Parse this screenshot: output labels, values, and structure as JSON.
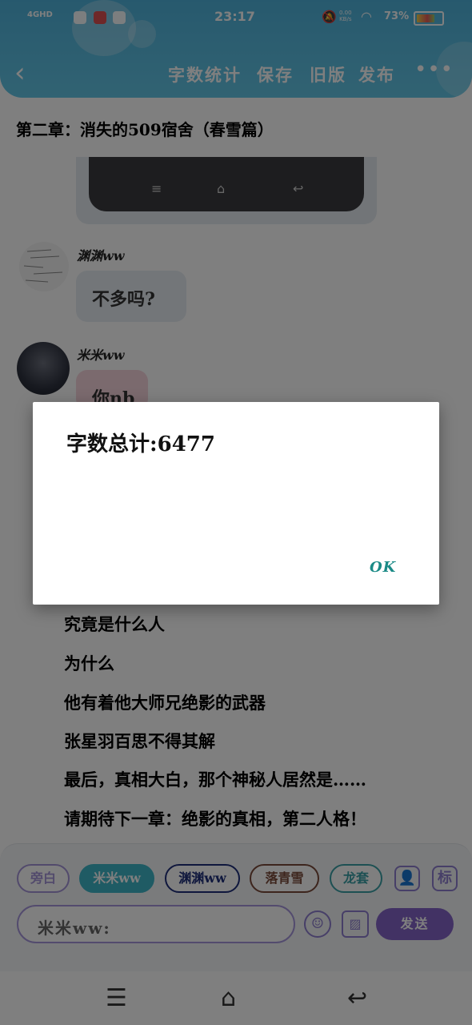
{
  "status_bar": {
    "network": "4GHD",
    "time": "23:17",
    "speed_value": "0.00",
    "speed_unit": "KB/s",
    "battery": "73%"
  },
  "header": {
    "back_icon": "back-arrow-icon",
    "buttons": [
      "字数统计",
      "保存",
      "旧版",
      "发布"
    ],
    "more_icon": "more-dots-icon",
    "color": "#5bbde3"
  },
  "chapter_title": "第二章：消失的509宿舍（春雪篇）",
  "chat": [
    {
      "user": "渊渊ww",
      "text": "不多吗?"
    },
    {
      "user": "米米ww",
      "text": "你nb"
    }
  ],
  "story_lines": [
    "究竟是什么人",
    "为什么",
    "他有着他大师兄绝影的武器",
    "张星羽百思不得其解",
    "最后，真相大白，那个神秘人居然是……",
    "请期待下一章：绝影的真相，第二人格！"
  ],
  "roles": [
    {
      "label": "旁白",
      "color": "#a595d8",
      "filled": false
    },
    {
      "label": "米米ww",
      "color": "#3fb6c9",
      "filled": true
    },
    {
      "label": "渊渊ww",
      "color": "#1e2f7a",
      "filled": false
    },
    {
      "label": "落青雪",
      "color": "#7a4a3a",
      "filled": false
    },
    {
      "label": "龙套",
      "color": "#3aa0a6",
      "filled": false
    }
  ],
  "panel_icons": {
    "person": "person-icon",
    "tag_label": "标",
    "emoji": "emoji-icon",
    "image": "image-icon"
  },
  "input": {
    "text": "米米ww:"
  },
  "send_label": "发送",
  "dialog": {
    "title": "字数总计:6477",
    "ok_label": "OK"
  },
  "accent": "#8465c8"
}
